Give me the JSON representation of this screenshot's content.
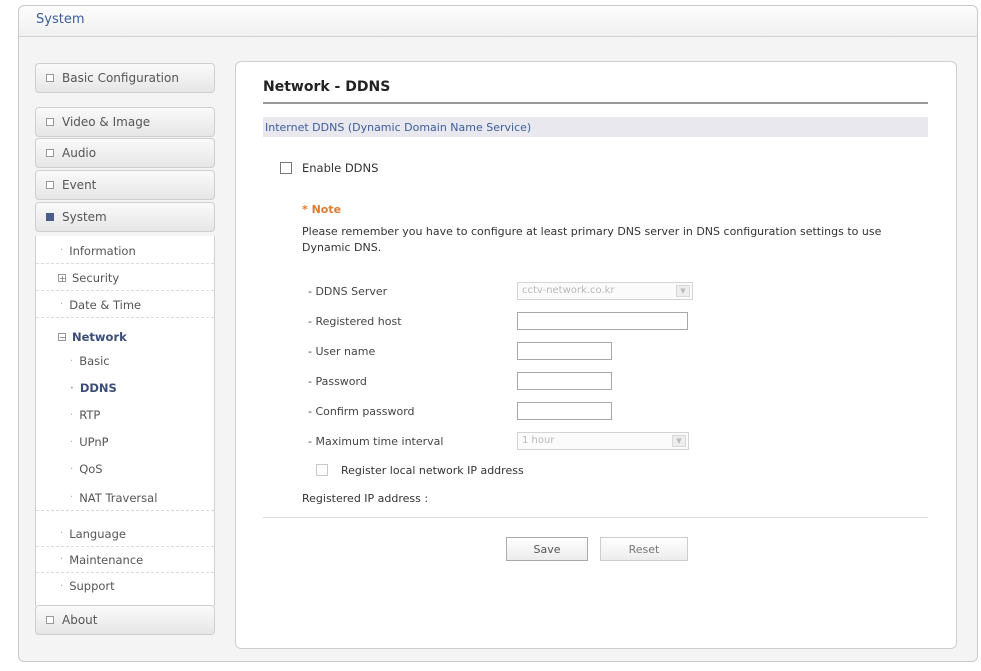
{
  "window": {
    "title": "System"
  },
  "sidebar": {
    "top_buttons": [
      {
        "label": "Basic Configuration"
      },
      {
        "label": "Video & Image"
      },
      {
        "label": "Audio"
      },
      {
        "label": "Event"
      },
      {
        "label": "System"
      }
    ],
    "system_items": [
      {
        "label": "Information"
      },
      {
        "label": "Security"
      },
      {
        "label": "Date & Time"
      },
      {
        "label": "Network"
      },
      {
        "label": "Basic"
      },
      {
        "label": "DDNS"
      },
      {
        "label": "RTP"
      },
      {
        "label": "UPnP"
      },
      {
        "label": "QoS"
      },
      {
        "label": "NAT Traversal"
      },
      {
        "label": "Language"
      },
      {
        "label": "Maintenance"
      },
      {
        "label": "Support"
      }
    ],
    "about": {
      "label": "About"
    }
  },
  "main": {
    "title": "Network - DDNS",
    "section": "Internet DDNS (Dynamic Domain Name Service)",
    "enable_label": "Enable DDNS",
    "note_title": "* Note",
    "note_text": "Please remember you have to configure at least primary DNS server in DNS configuration settings to use Dynamic DNS.",
    "fields": {
      "ddns_server": {
        "label": "- DDNS Server",
        "value": "cctv-network.co.kr"
      },
      "registered_host": {
        "label": "- Registered host",
        "value": ""
      },
      "user_name": {
        "label": "- User name",
        "value": ""
      },
      "password": {
        "label": "- Password",
        "value": ""
      },
      "confirm_password": {
        "label": "- Confirm password",
        "value": ""
      },
      "max_interval": {
        "label": "- Maximum time interval",
        "value": "1 hour"
      }
    },
    "register_local_label": "Register local network IP address",
    "registered_ip_label": "Registered IP address :",
    "registered_ip_value": "",
    "save_label": "Save",
    "reset_label": "Reset"
  },
  "colors": {
    "accent": "#3b5e9a",
    "note": "#e07a2c",
    "active": "#4a5e8a"
  }
}
